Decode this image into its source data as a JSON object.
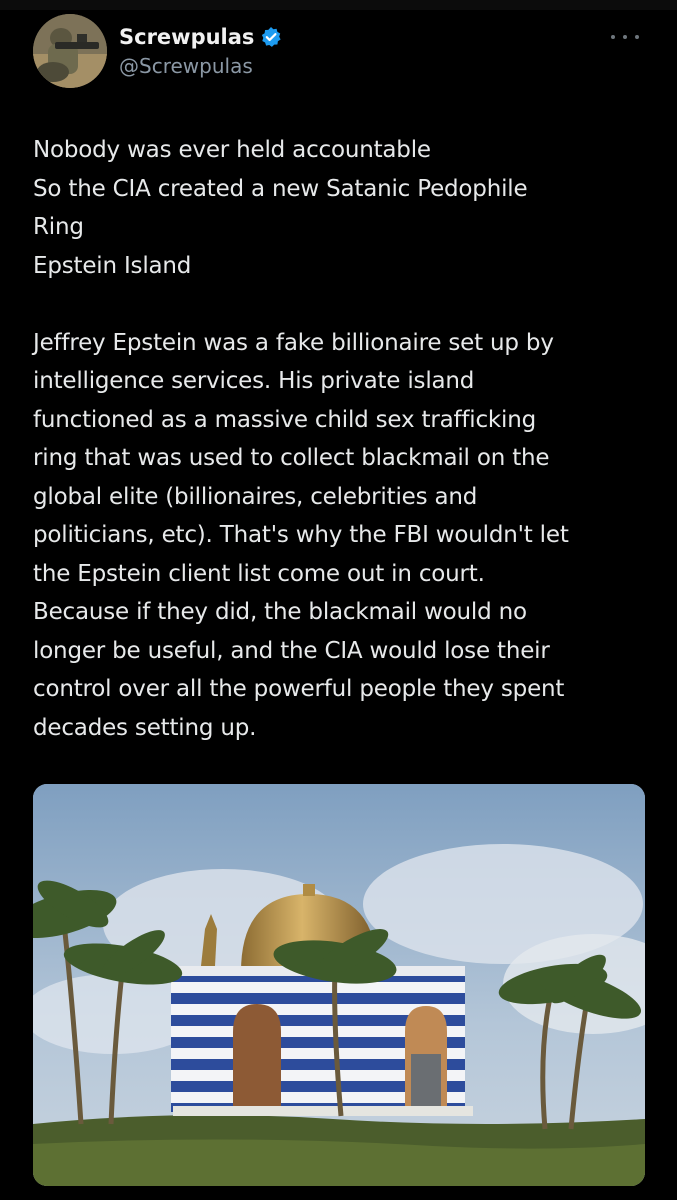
{
  "tweet": {
    "author": {
      "display_name": "Screwpulas",
      "handle": "@Screwpulas",
      "verified": true,
      "verified_color": "#1d9bf0"
    },
    "more_icon": "more-horizontal-icon",
    "text_block_1": [
      "Nobody was ever held accountable",
      "So the CIA created a new Satanic Pedophile",
      "Ring",
      "Epstein Island"
    ],
    "text_block_2": [
      "Jeffrey Epstein was a fake billionaire set up by",
      "intelligence services. His private island",
      "functioned as a massive child sex trafficking",
      "ring that was used to collect blackmail on the",
      "global elite (billionaires, celebrities and",
      "politicians, etc). That's why the FBI wouldn't let",
      "the Epstein client list come out in court.",
      "Because if they did, the blackmail would no",
      "longer be useful, and the CIA would lose their",
      "control over all the powerful people they spent",
      "decades setting up."
    ],
    "media": {
      "kind": "photo",
      "subject": "striped temple with golden dome and palm trees"
    }
  },
  "colors": {
    "background": "#000000",
    "text_primary": "#e7e9ea",
    "text_secondary": "#8b98a5"
  }
}
